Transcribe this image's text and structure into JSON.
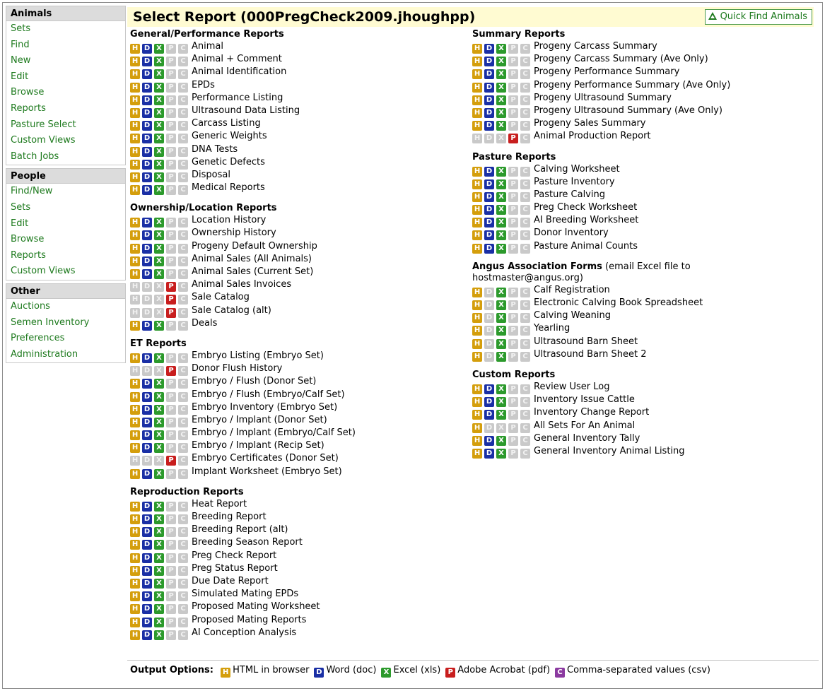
{
  "title": "Select Report (000PregCheck2009.jhoughpp)",
  "quick_find_label": "Quick Find Animals",
  "colors": {
    "html": "#d49e0c",
    "doc": "#1a2fa5",
    "xls": "#2c9a2c",
    "pdf": "#c81e1e",
    "csv": "#8b3aa0",
    "disabled": "#c9c9c9",
    "nav_link": "#1e7a1e",
    "header_bg": "#fffbd2"
  },
  "badge_letters": {
    "html": "H",
    "doc": "D",
    "xls": "X",
    "pdf": "P",
    "csv": "C"
  },
  "sidebar": {
    "groups": [
      {
        "title": "Animals",
        "items": [
          "Sets",
          "Find",
          "New",
          "Edit",
          "Browse",
          "Reports",
          "Pasture Select",
          "Custom Views",
          "Batch Jobs"
        ]
      },
      {
        "title": "People",
        "items": [
          "Find/New",
          "Sets",
          "Edit",
          "Browse",
          "Reports",
          "Custom Views"
        ]
      },
      {
        "title": "Other",
        "items": [
          "Auctions",
          "Semen Inventory",
          "Preferences",
          "Administration"
        ]
      }
    ]
  },
  "left_sections": [
    {
      "title": "General/Performance Reports",
      "reports": [
        {
          "label": "Animal",
          "formats": "HDX"
        },
        {
          "label": "Animal + Comment",
          "formats": "HDX"
        },
        {
          "label": "Animal Identification",
          "formats": "HDX"
        },
        {
          "label": "EPDs",
          "formats": "HDX"
        },
        {
          "label": "Performance Listing",
          "formats": "HDX"
        },
        {
          "label": "Ultrasound Data Listing",
          "formats": "HDX"
        },
        {
          "label": "Carcass Listing",
          "formats": "HDX"
        },
        {
          "label": "Generic Weights",
          "formats": "HDX"
        },
        {
          "label": "DNA Tests",
          "formats": "HDX"
        },
        {
          "label": "Genetic Defects",
          "formats": "HDX"
        },
        {
          "label": "Disposal",
          "formats": "HDX"
        },
        {
          "label": "Medical Reports",
          "formats": "HDX"
        }
      ]
    },
    {
      "title": "Ownership/Location Reports",
      "reports": [
        {
          "label": "Location History",
          "formats": "HDX"
        },
        {
          "label": "Ownership History",
          "formats": "HDX"
        },
        {
          "label": "Progeny Default Ownership",
          "formats": "HDX"
        },
        {
          "label": "Animal Sales (All Animals)",
          "formats": "HDX"
        },
        {
          "label": "Animal Sales (Current Set)",
          "formats": "HDX"
        },
        {
          "label": "Animal Sales Invoices",
          "formats": "P"
        },
        {
          "label": "Sale Catalog",
          "formats": "P"
        },
        {
          "label": "Sale Catalog (alt)",
          "formats": "P"
        },
        {
          "label": "Deals",
          "formats": "HDX"
        }
      ]
    },
    {
      "title": "ET Reports",
      "reports": [
        {
          "label": "Embryo Listing (Embryo Set)",
          "formats": "HDX"
        },
        {
          "label": "Donor Flush History",
          "formats": "P"
        },
        {
          "label": "Embryo / Flush (Donor Set)",
          "formats": "HDX"
        },
        {
          "label": "Embryo / Flush (Embryo/Calf Set)",
          "formats": "HDX"
        },
        {
          "label": "Embryo Inventory (Embryo Set)",
          "formats": "HDX"
        },
        {
          "label": "Embryo / Implant (Donor Set)",
          "formats": "HDX"
        },
        {
          "label": "Embryo / Implant (Embryo/Calf Set)",
          "formats": "HDX"
        },
        {
          "label": "Embryo / Implant (Recip Set)",
          "formats": "HDX"
        },
        {
          "label": "Embryo Certificates (Donor Set)",
          "formats": "P"
        },
        {
          "label": "Implant Worksheet (Embryo Set)",
          "formats": "HDX"
        }
      ]
    },
    {
      "title": "Reproduction Reports",
      "reports": [
        {
          "label": "Heat Report",
          "formats": "HDX"
        },
        {
          "label": "Breeding Report",
          "formats": "HDX"
        },
        {
          "label": "Breeding Report (alt)",
          "formats": "HDX"
        },
        {
          "label": "Breeding Season Report",
          "formats": "HDX"
        },
        {
          "label": "Preg Check Report",
          "formats": "HDX"
        },
        {
          "label": "Preg Status Report",
          "formats": "HDX"
        },
        {
          "label": "Due Date Report",
          "formats": "HDX"
        },
        {
          "label": "Simulated Mating EPDs",
          "formats": "HDX"
        },
        {
          "label": "Proposed Mating Worksheet",
          "formats": "HDX"
        },
        {
          "label": "Proposed Mating Reports",
          "formats": "HDX"
        },
        {
          "label": "AI Conception Analysis",
          "formats": "HDX"
        }
      ]
    }
  ],
  "right_sections": [
    {
      "title": "Summary Reports",
      "reports": [
        {
          "label": "Progeny Carcass Summary",
          "formats": "HDX"
        },
        {
          "label": "Progeny Carcass Summary (Ave Only)",
          "formats": "HDX"
        },
        {
          "label": "Progeny Performance Summary",
          "formats": "HDX"
        },
        {
          "label": "Progeny Performance Summary (Ave Only)",
          "formats": "HDX"
        },
        {
          "label": "Progeny Ultrasound Summary",
          "formats": "HDX"
        },
        {
          "label": "Progeny Ultrasound Summary (Ave Only)",
          "formats": "HDX"
        },
        {
          "label": "Progeny Sales Summary",
          "formats": "HDX"
        },
        {
          "label": "Animal Production Report",
          "formats": "P"
        }
      ]
    },
    {
      "title": "Pasture Reports",
      "reports": [
        {
          "label": "Calving Worksheet",
          "formats": "HDX"
        },
        {
          "label": "Pasture Inventory",
          "formats": "HDX"
        },
        {
          "label": "Pasture Calving",
          "formats": "HDX"
        },
        {
          "label": "Preg Check Worksheet",
          "formats": "HDX"
        },
        {
          "label": "AI Breeding Worksheet",
          "formats": "HDX"
        },
        {
          "label": "Donor Inventory",
          "formats": "HDX"
        },
        {
          "label": "Pasture Animal Counts",
          "formats": "HDX"
        }
      ]
    },
    {
      "title": "Angus Association Forms",
      "note": " (email Excel file to hostmaster@angus.org)",
      "reports": [
        {
          "label": "Calf Registration",
          "formats": "HX"
        },
        {
          "label": "Electronic Calving Book Spreadsheet",
          "formats": "HX"
        },
        {
          "label": "Calving Weaning",
          "formats": "HX"
        },
        {
          "label": "Yearling",
          "formats": "HX"
        },
        {
          "label": "Ultrasound Barn Sheet",
          "formats": "HX"
        },
        {
          "label": "Ultrasound Barn Sheet 2",
          "formats": "HX"
        }
      ]
    },
    {
      "title": "Custom Reports",
      "reports": [
        {
          "label": "Review User Log",
          "formats": "HDX"
        },
        {
          "label": "Inventory Issue Cattle",
          "formats": "HDX"
        },
        {
          "label": "Inventory Change Report",
          "formats": "HDX"
        },
        {
          "label": "All Sets For An Animal",
          "formats": "H"
        },
        {
          "label": "General Inventory Tally",
          "formats": "HDX"
        },
        {
          "label": "General Inventory Animal Listing",
          "formats": "HDX"
        }
      ]
    }
  ],
  "footer": {
    "label": "Output Options:",
    "options": [
      {
        "letter": "H",
        "text": "HTML in browser"
      },
      {
        "letter": "D",
        "text": "Word (doc)"
      },
      {
        "letter": "X",
        "text": "Excel (xls)"
      },
      {
        "letter": "P",
        "text": "Adobe Acrobat (pdf)"
      },
      {
        "letter": "C",
        "text": "Comma-separated values (csv)"
      }
    ]
  }
}
